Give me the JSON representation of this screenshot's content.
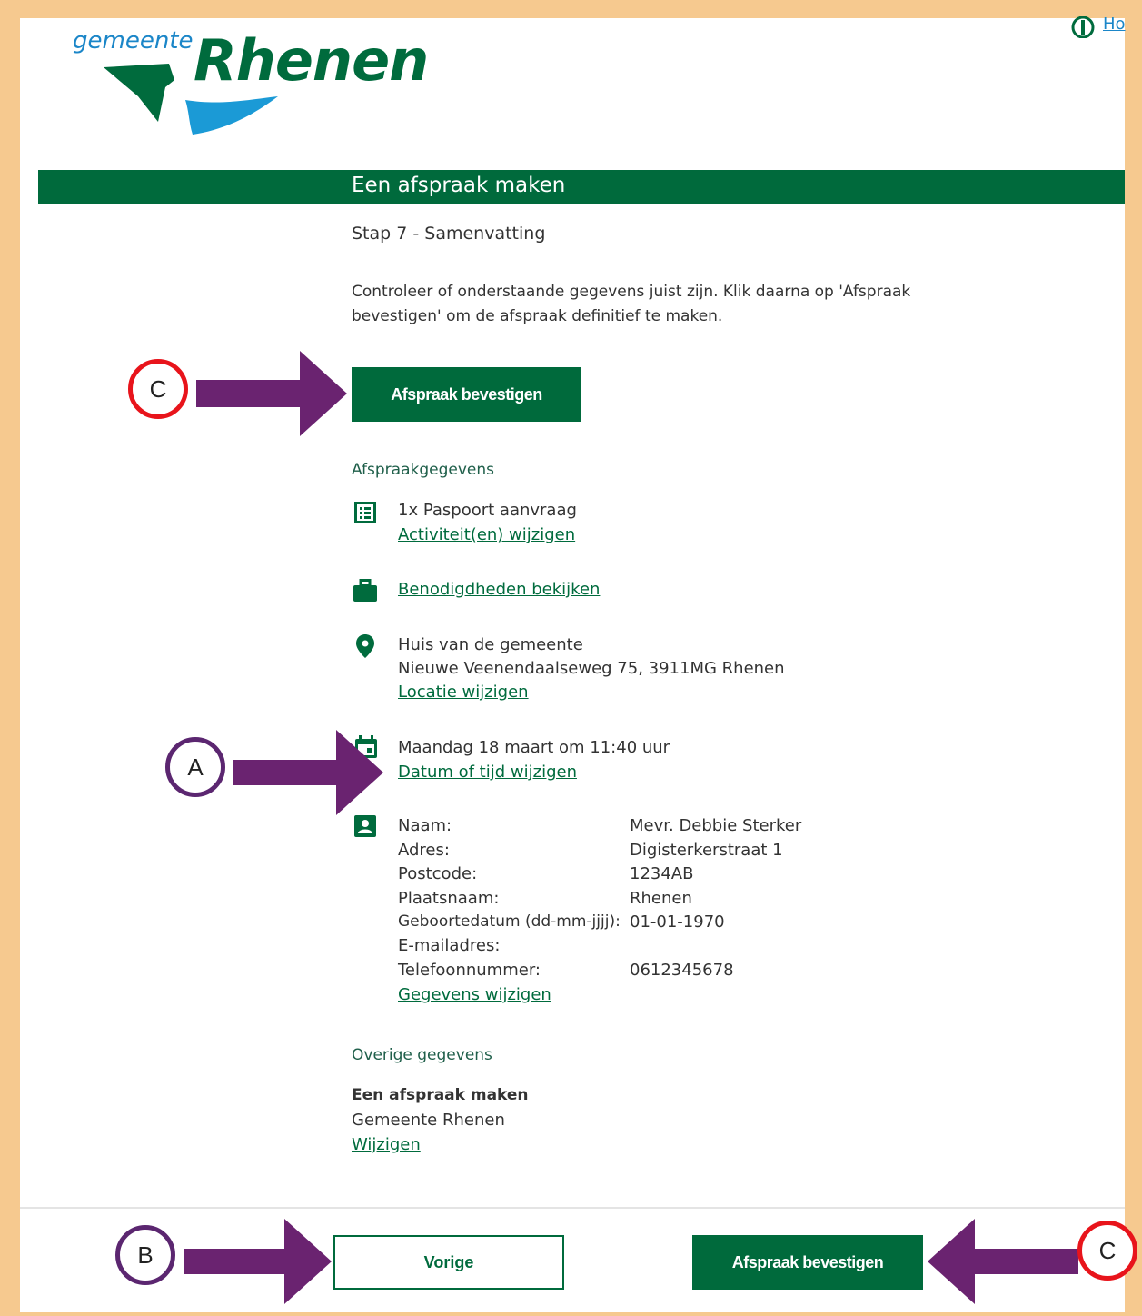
{
  "header": {
    "logo_small": "gemeente",
    "logo_big": "Rhenen",
    "top_link": "Ho"
  },
  "banner": {
    "title": "Een afspraak maken"
  },
  "step": "Stap 7 - Samenvatting",
  "intro": {
    "line1": "Controleer of onderstaande gegevens juist zijn. Klik daarna op 'Afspraak",
    "line2": "bevestigen' om de afspraak definitief te maken."
  },
  "confirm_button": "Afspraak bevestigen",
  "appointment": {
    "section_title": "Afspraakgegevens",
    "activity": "1x Paspoort aanvraag",
    "activity_link": "Activiteit(en) wijzigen",
    "requirements_link": "Benodigdheden bekijken",
    "location_name": "Huis van de gemeente",
    "location_address": "Nieuwe Veenendaalseweg 75, 3911MG Rhenen",
    "location_link": "Locatie wijzigen",
    "datetime": "Maandag 18 maart om 11:40 uur",
    "datetime_link": "Datum of tijd wijzigen",
    "personal": [
      {
        "label": "Naam:",
        "value": "Mevr. Debbie Sterker"
      },
      {
        "label": "Adres:",
        "value": "Digisterkerstraat 1"
      },
      {
        "label": "Postcode:",
        "value": "1234AB"
      },
      {
        "label": "Plaatsnaam:",
        "value": "Rhenen"
      },
      {
        "label": "Geboortedatum (dd-mm-jjjj):",
        "value": "01-01-1970"
      },
      {
        "label": "E-mailadres:",
        "value": ""
      },
      {
        "label": "Telefoonnummer:",
        "value": "0612345678"
      }
    ],
    "personal_link": "Gegevens wijzigen"
  },
  "other": {
    "section_title": "Overige gegevens",
    "title": "Een afspraak maken",
    "subtitle": "Gemeente Rhenen",
    "link": "Wijzigen"
  },
  "footer": {
    "previous": "Vorige",
    "confirm": "Afspraak bevestigen"
  },
  "annotations": {
    "c_top": "C",
    "a": "A",
    "b": "B",
    "c_bottom": "C"
  },
  "colors": {
    "frame": "#f6c98f",
    "brand_green": "#006a3c",
    "brand_blue": "#1b86c8",
    "arrow_purple": "#6a2370",
    "circle_red": "#e8141b",
    "circle_purple": "#5b2670"
  }
}
